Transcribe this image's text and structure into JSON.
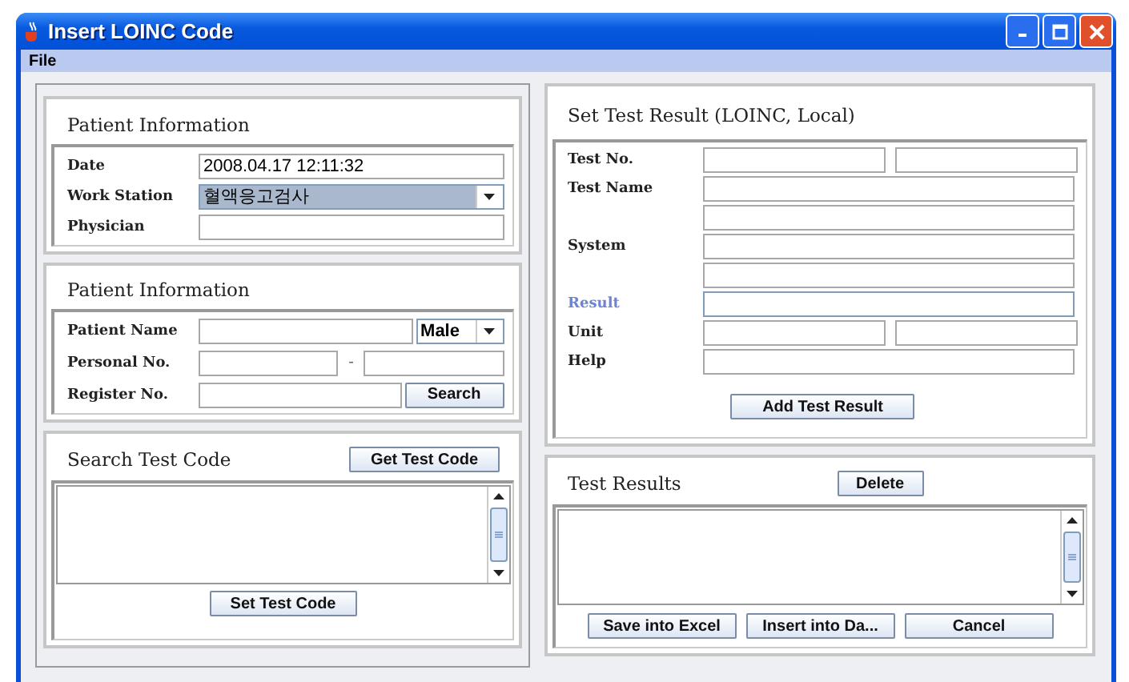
{
  "window": {
    "title": "Insert LOINC Code"
  },
  "menu": [
    "File"
  ],
  "patient_info": {
    "title": "Patient Information",
    "fields": [
      {
        "label": "Date",
        "kind": "text",
        "value": "2008.04.17 12:11:32"
      },
      {
        "label": "Work Station",
        "kind": "combo",
        "value": "혈액응고검사",
        "focused": true
      },
      {
        "label": "Physician",
        "kind": "text"
      }
    ]
  },
  "patient": {
    "title": "Patient Information",
    "name_label": "Patient Name",
    "gender": "Male",
    "personal_label": "Personal No.",
    "separator": "-",
    "register_label": "Register No.",
    "search_button": "Search"
  },
  "search_code": {
    "title": "Search Test Code",
    "get_button": "Get Test Code",
    "set_button": "Set Test Code"
  },
  "test_result": {
    "title": "Set Test Result (LOINC, Local)",
    "rows": [
      {
        "label": "Test No.",
        "kind": "pair",
        "active": false
      },
      {
        "label": "Test Name",
        "kind": "single",
        "active": false
      },
      {
        "kind": "single",
        "active": false
      },
      {
        "label": "System",
        "kind": "single",
        "active": false
      },
      {
        "kind": "single",
        "active": false
      },
      {
        "label": "Result",
        "kind": "single",
        "active": true
      },
      {
        "label": "Unit",
        "kind": "pair",
        "active": false
      },
      {
        "label": "Help",
        "kind": "single",
        "active": false
      }
    ],
    "add_button": "Add Test Result"
  },
  "test_results": {
    "title": "Test Results",
    "delete_button": "Delete",
    "buttons": [
      "Save into Excel",
      "Insert into Da...",
      "Cancel"
    ]
  }
}
